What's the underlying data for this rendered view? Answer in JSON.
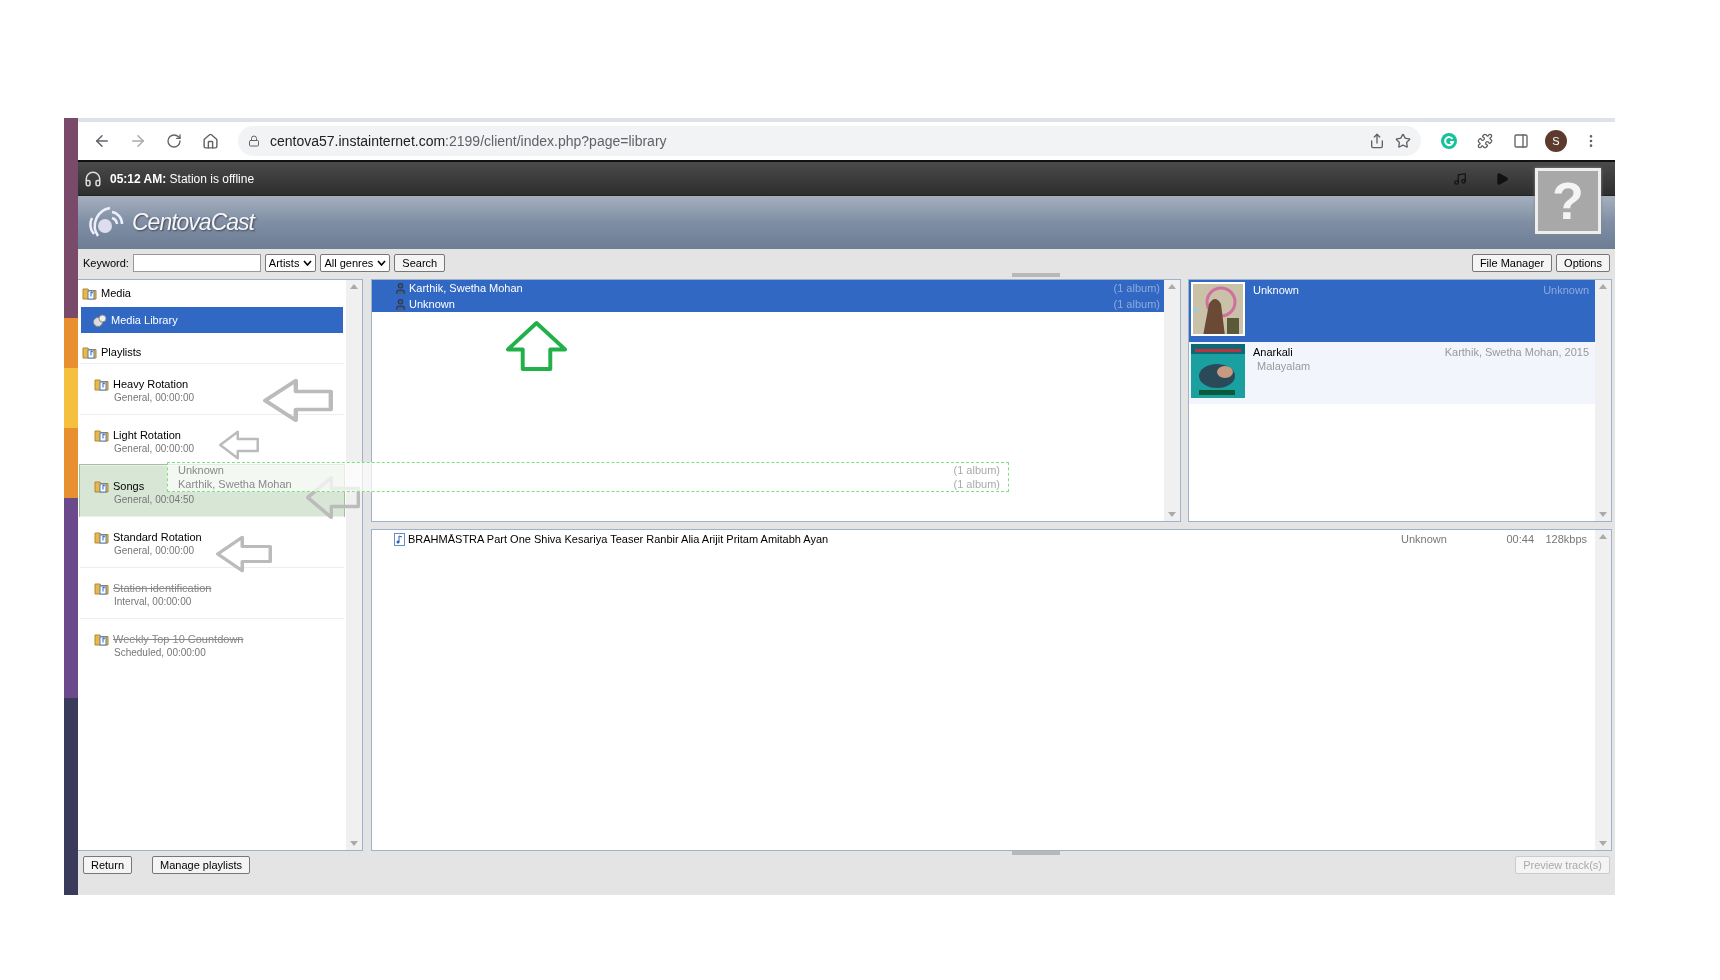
{
  "browser": {
    "url_host": "centova57.instainternet.com",
    "url_path": ":2199/client/index.php?page=library",
    "avatar": "S"
  },
  "status_bar": {
    "time": "05:12 AM:",
    "text": "Station is offline"
  },
  "header": {
    "logo": "CentovaCast",
    "help": "?"
  },
  "toolbar": {
    "keyword_label": "Keyword:",
    "selects": [
      "Artists",
      "All genres"
    ],
    "search_button": "Search",
    "right_buttons": [
      "File Manager",
      "Options"
    ]
  },
  "sidebar": {
    "media_label": "Media",
    "library": {
      "label": "Media Library",
      "selected": true
    },
    "playlists_label": "Playlists",
    "playlists": [
      {
        "title": "Heavy Rotation",
        "subtitle": "General, 00:00:00",
        "selected": false,
        "disabled": false,
        "highlighted": false
      },
      {
        "title": "Light Rotation",
        "subtitle": "General, 00:00:00",
        "selected": false,
        "disabled": false,
        "highlighted": false
      },
      {
        "title": "Songs",
        "subtitle": "General, 00:04:50",
        "selected": false,
        "disabled": false,
        "highlighted": true
      },
      {
        "title": "Standard Rotation",
        "subtitle": "General, 00:00:00",
        "selected": false,
        "disabled": false,
        "highlighted": false
      },
      {
        "title": "Station identification",
        "subtitle": "Interval, 00:00:00",
        "selected": false,
        "disabled": true,
        "highlighted": false
      },
      {
        "title": "Weekly Top 10 Countdown",
        "subtitle": "Scheduled, 00:00:00",
        "selected": false,
        "disabled": true,
        "highlighted": false
      }
    ]
  },
  "artists": [
    {
      "name": "Karthik, Swetha Mohan",
      "count": "(1 album)",
      "selected": true
    },
    {
      "name": "Unknown",
      "count": "(1 album)",
      "selected": true
    }
  ],
  "drag_ghost": [
    {
      "name": "Unknown",
      "count": "(1 album)"
    },
    {
      "name": "Karthik, Swetha Mohan",
      "count": "(1 album)"
    }
  ],
  "albums": [
    {
      "title": "Unknown",
      "detail": "Unknown",
      "selected": true
    },
    {
      "title": "Anarkali",
      "detail": "Karthik, Swetha Mohan, 2015",
      "genre": "Malayalam",
      "selected": false
    }
  ],
  "tracks": [
    {
      "title": "BRAHMĀSTRA Part One Shiva Kesariya Teaser Ranbir Alia Arijit Pritam Amitabh Ayan",
      "artist": "Unknown",
      "length": "00:44",
      "bitrate": "128kbps"
    }
  ],
  "footer": {
    "buttons": [
      "Return",
      "Manage playlists"
    ],
    "preview": {
      "label": "Preview track(s)",
      "disabled": true
    }
  }
}
